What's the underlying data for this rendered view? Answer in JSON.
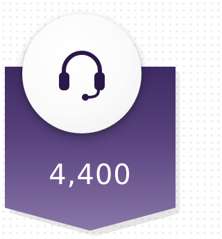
{
  "stat": {
    "icon": "headset-icon",
    "value": "4,400"
  },
  "colors": {
    "card_top": "#3e2a62",
    "card_bottom": "#8a76a8",
    "icon_color": "#2b1848",
    "circle": "#ffffff"
  }
}
